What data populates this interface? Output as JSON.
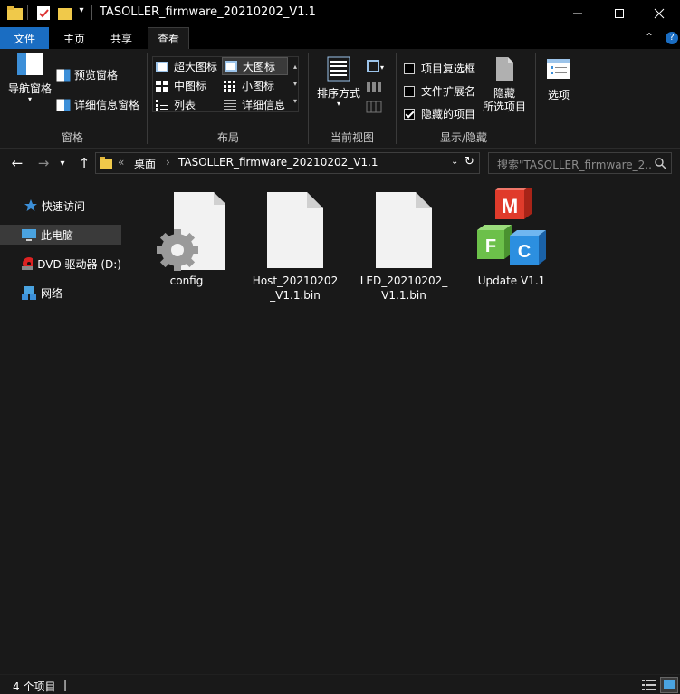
{
  "window": {
    "title": "TASOLLER_firmware_20210202_V1.1"
  },
  "tabs": {
    "file": "文件",
    "home": "主页",
    "share": "共享",
    "view": "查看"
  },
  "ribbon": {
    "panes": {
      "nav_pane": "导航窗格",
      "preview_pane": "预览窗格",
      "details_pane": "详细信息窗格",
      "group": "窗格"
    },
    "layout": {
      "extra_large": "超大图标",
      "large": "大图标",
      "medium": "中图标",
      "small": "小图标",
      "list": "列表",
      "details": "详细信息",
      "group": "布局"
    },
    "current_view": {
      "sort_by": "排序方式",
      "group": "当前视图"
    },
    "show_hide": {
      "item_checkboxes": "项目复选框",
      "file_extensions": "文件扩展名",
      "hidden_items": "隐藏的项目",
      "hide_selected_1": "隐藏",
      "hide_selected_2": "所选项目",
      "group": "显示/隐藏",
      "item_checkboxes_checked": false,
      "file_extensions_checked": false,
      "hidden_items_checked": true
    },
    "options": "选项"
  },
  "address": {
    "overflow": "«",
    "crumb1": "桌面",
    "crumb_sep": "›",
    "crumb2": "TASOLLER_firmware_20210202_V1.1",
    "search_placeholder": "搜索\"TASOLLER_firmware_2..."
  },
  "nav": {
    "quick_access": "快速访问",
    "this_pc": "此电脑",
    "dvd_drive": "DVD 驱动器 (D:)",
    "network": "网络"
  },
  "files": [
    {
      "name": "config",
      "icon": "config-settings-icon"
    },
    {
      "name": "Host_20210202\n_V1.1.bin",
      "icon": "generic-file-icon"
    },
    {
      "name": "LED_20210202_\nV1.1.bin",
      "icon": "generic-file-icon"
    },
    {
      "name": "Update V1.1",
      "icon": "mfc-application-icon"
    }
  ],
  "status": {
    "item_count": "4 个项目",
    "cursor": "|"
  },
  "colors": {
    "accent": "#1a6dc2",
    "background": "#191919",
    "titlebar": "#000000",
    "selected": "#3a3a3a"
  }
}
